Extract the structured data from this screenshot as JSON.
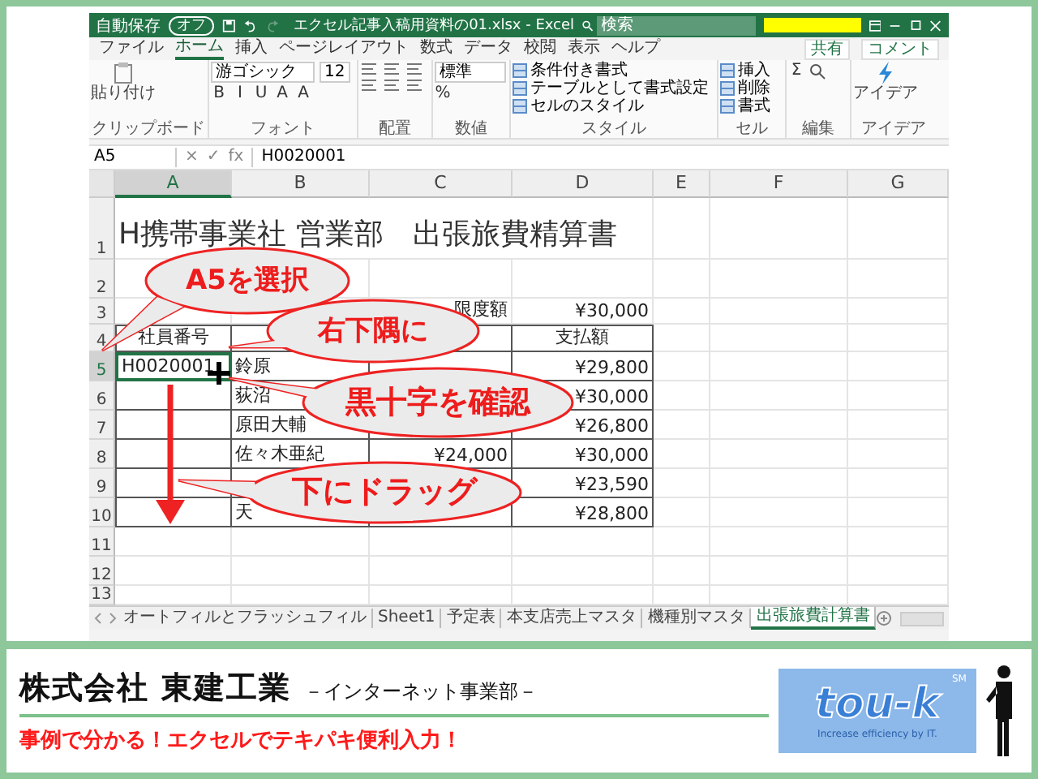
{
  "window": {
    "autosave_label": "自動保存",
    "autosave_state": "オフ",
    "autosave_on": false,
    "title": "エクセル記事入稿用資料の01.xlsx - Excel",
    "search_placeholder": "検索"
  },
  "ribbon_tabs": [
    {
      "label": "ファイル",
      "selected": false
    },
    {
      "label": "ホーム",
      "selected": true
    },
    {
      "label": "挿入",
      "selected": false
    },
    {
      "label": "ページレイアウト",
      "selected": false
    },
    {
      "label": "数式",
      "selected": false
    },
    {
      "label": "データ",
      "selected": false
    },
    {
      "label": "校閲",
      "selected": false
    },
    {
      "label": "表示",
      "selected": false
    },
    {
      "label": "ヘルプ",
      "selected": false
    }
  ],
  "share": "共有",
  "comment": "コメント",
  "ribbon_groups": [
    {
      "kind": "clipboard",
      "label": "クリップボード",
      "items": [
        {
          "kind": "big",
          "text": "貼り付け"
        }
      ]
    },
    {
      "kind": "font",
      "label": "フォント",
      "items": [
        {
          "kind": "field",
          "text": "游ゴシック"
        },
        {
          "kind": "field",
          "text": "12"
        },
        {
          "kind": "glyph",
          "text": "B"
        },
        {
          "kind": "glyph",
          "text": "I"
        },
        {
          "kind": "glyph",
          "text": "U"
        },
        {
          "kind": "glyph",
          "text": "A"
        },
        {
          "kind": "glyph",
          "text": "A"
        }
      ]
    },
    {
      "kind": "align",
      "label": "配置"
    },
    {
      "kind": "number",
      "label": "数値",
      "items": [
        {
          "kind": "field",
          "text": "標準"
        },
        {
          "kind": "glyph",
          "text": "%"
        }
      ]
    },
    {
      "kind": "styles",
      "label": "スタイル",
      "items": [
        {
          "kind": "line",
          "text": "条件付き書式"
        },
        {
          "kind": "line",
          "text": "テーブルとして書式設定"
        },
        {
          "kind": "line",
          "text": "セルのスタイル"
        }
      ]
    },
    {
      "kind": "cells",
      "label": "セル",
      "items": [
        {
          "kind": "line",
          "text": "挿入"
        },
        {
          "kind": "line",
          "text": "削除"
        },
        {
          "kind": "line",
          "text": "書式"
        }
      ]
    },
    {
      "kind": "edit",
      "label": "編集",
      "items": [
        {
          "kind": "glyph",
          "text": "Σ"
        }
      ]
    },
    {
      "kind": "ideas",
      "label": "アイデア",
      "items": [
        {
          "kind": "big",
          "text": "アイデア"
        }
      ]
    }
  ],
  "name_box": "A5",
  "formula_buttons": [
    "×",
    "✓",
    "fx"
  ],
  "formula": "H0020001",
  "columns": [
    {
      "label": "A",
      "selected": true
    },
    {
      "label": "B",
      "selected": false
    },
    {
      "label": "C",
      "selected": false
    },
    {
      "label": "D",
      "selected": false
    },
    {
      "label": "E",
      "selected": false
    },
    {
      "label": "F",
      "selected": false
    },
    {
      "label": "G",
      "selected": false
    }
  ],
  "rows": [
    {
      "label": "1",
      "kind": "title",
      "selected": false,
      "cells": {
        "a": "H携帯事業社 営業部　出張旅費精算書"
      }
    },
    {
      "label": "2",
      "kind": "blank",
      "selected": false,
      "cells": {}
    },
    {
      "label": "3",
      "kind": "plain",
      "selected": false,
      "cells": {
        "c": "限度額",
        "d": "¥30,000"
      }
    },
    {
      "label": "4",
      "kind": "header",
      "selected": false,
      "cells": {
        "a": "社員番号",
        "d": "支払額"
      }
    },
    {
      "label": "5",
      "kind": "data",
      "selected": true,
      "cells": {
        "a": "H0020001",
        "b": "鈴原",
        "d": "¥29,800"
      }
    },
    {
      "label": "6",
      "kind": "data",
      "selected": false,
      "cells": {
        "b": "荻沼",
        "d": "¥30,000"
      }
    },
    {
      "label": "7",
      "kind": "data",
      "selected": false,
      "cells": {
        "b": "原田大輔",
        "d": "¥26,800"
      }
    },
    {
      "label": "8",
      "kind": "data",
      "selected": false,
      "cells": {
        "b": "佐々木亜紀",
        "c": "¥24,000",
        "d": "¥30,000"
      }
    },
    {
      "label": "9",
      "kind": "data",
      "selected": false,
      "cells": {
        "d": "¥23,590"
      }
    },
    {
      "label": "10",
      "kind": "data",
      "selected": false,
      "cells": {
        "b": "天",
        "d": "¥28,800"
      }
    },
    {
      "label": "11",
      "kind": "blank",
      "selected": false,
      "cells": {}
    },
    {
      "label": "12",
      "kind": "blank",
      "selected": false,
      "cells": {}
    },
    {
      "label": "13",
      "kind": "blank",
      "selected": false,
      "cells": {}
    }
  ],
  "callouts": [
    {
      "text": "A5を選択"
    },
    {
      "text": "右下隅に"
    },
    {
      "text": "黒十字を確認"
    },
    {
      "text": "下にドラッグ"
    }
  ],
  "sheet_tabs": [
    {
      "label": "オートフィルとフラッシュフィル",
      "selected": false
    },
    {
      "label": "Sheet1",
      "selected": false
    },
    {
      "label": "予定表",
      "selected": false
    },
    {
      "label": "本支店売上マスタ",
      "selected": false
    },
    {
      "label": "機種別マスタ",
      "selected": false
    },
    {
      "label": "出張旅費計算書",
      "selected": true
    }
  ],
  "footer": {
    "company": "株式会社 東建工業",
    "division": "－インターネット事業部－",
    "tagline": "事例で分かる！エクセルでテキパキ便利入力！",
    "logo": "tou-k",
    "logo_mark": "SM",
    "logo_slogan": "Increase efficiency by IT."
  }
}
